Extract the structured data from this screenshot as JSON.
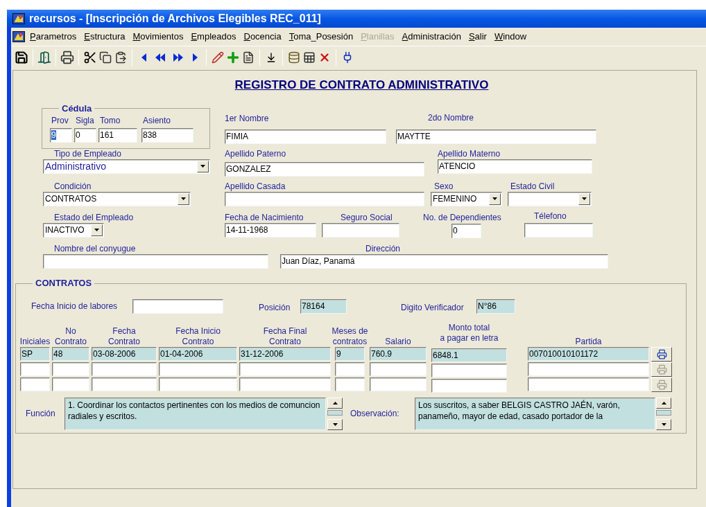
{
  "window": {
    "title": "recursos - [Inscripción de Archivos Elegibles REC_011]"
  },
  "menu": [
    {
      "label": "Parametros",
      "disabled": false
    },
    {
      "label": "Estructura",
      "disabled": false
    },
    {
      "label": "Movimientos",
      "disabled": false
    },
    {
      "label": "Empleados",
      "disabled": false
    },
    {
      "label": "Docencia",
      "disabled": false
    },
    {
      "label": "Toma_Posesión",
      "disabled": false
    },
    {
      "label": "Planillas",
      "disabled": true
    },
    {
      "label": "Administración",
      "disabled": false
    },
    {
      "label": "Salir",
      "disabled": false
    },
    {
      "label": "Window",
      "disabled": false
    }
  ],
  "form": {
    "title": "REGISTRO DE CONTRATO ADMINISTRATIVO",
    "cedula": {
      "legend": "Cédula",
      "fields": [
        {
          "label": "Prov",
          "value": "9",
          "selected": true
        },
        {
          "label": "Sigla",
          "value": "0",
          "selected": false
        },
        {
          "label": "Tomo",
          "value": "161",
          "selected": false
        },
        {
          "label": "Asiento",
          "value": "838",
          "selected": false
        }
      ]
    },
    "fields": [
      {
        "label": "1er Nombre",
        "value": "FIMIA",
        "kind": "text"
      },
      {
        "label": "2do Nombre",
        "value": "MAYTTE",
        "kind": "text"
      },
      {
        "label": "Tipo de Empleado",
        "value": "Administrativo",
        "kind": "select"
      },
      {
        "label": "Apellido Paterno",
        "value": "GONZALEZ",
        "kind": "text"
      },
      {
        "label": "Apellido Materno",
        "value": "ATENCIO",
        "kind": "text"
      },
      {
        "label": "Condición",
        "value": "CONTRATOS",
        "kind": "select"
      },
      {
        "label": "Apellido Casada",
        "kind": "text"
      },
      {
        "label": "Sexo",
        "value": "FEMENINO",
        "kind": "select"
      },
      {
        "label": "Estado Civil",
        "kind": "select"
      },
      {
        "label": "Estado del Empleado",
        "value": "INACTIVO",
        "kind": "select"
      },
      {
        "label": "Fecha de Nacimiento",
        "value": "14-11-1968",
        "kind": "text"
      },
      {
        "label": "Seguro Social",
        "kind": "text"
      },
      {
        "label": "No. de Dependientes",
        "value": "0",
        "kind": "text"
      },
      {
        "label": "Télefono",
        "kind": "text"
      },
      {
        "label": "Nombre del conyugue",
        "kind": "text"
      },
      {
        "label": "Dirección",
        "value": "Juan Díaz, Panamá",
        "kind": "text"
      }
    ]
  },
  "contratos": {
    "legend": "CONTRATOS",
    "fecha_inicio": {
      "label": "Fecha Inicio de labores"
    },
    "posicion": {
      "label": "Posición",
      "value": "78164"
    },
    "digito": {
      "label": "Digito Verificador",
      "value": "N°86"
    },
    "columns": [
      {
        "header": "Iniciales"
      },
      {
        "header": "No\nContrato"
      },
      {
        "header": "Fecha\nContrato"
      },
      {
        "header": "Fecha Inicio\nContrato"
      },
      {
        "header": "Fecha Final\nContrato"
      },
      {
        "header": "Meses de\ncontratos"
      },
      {
        "header": "Salario"
      },
      {
        "header": "Monto total\na pagar en letra"
      },
      {
        "header": "Partida"
      }
    ],
    "rows": [
      {
        "current": true,
        "cells": [
          "SP",
          "48",
          "03-08-2006",
          "01-04-2006",
          "31-12-2006",
          "9",
          "760.9",
          "6848.1",
          "007010010101172"
        ]
      },
      {
        "current": false
      },
      {
        "current": false
      }
    ],
    "funcion": {
      "label": "Función",
      "value": "1. Coordinar los contactos pertinentes con los medios de comuncion radiales y escritos."
    },
    "observacion": {
      "label": "Observación:",
      "value": "Los suscritos, a saber  BELGIS CASTRO JAÉN, varón, panameño, mayor de edad, casado portador de la"
    }
  }
}
